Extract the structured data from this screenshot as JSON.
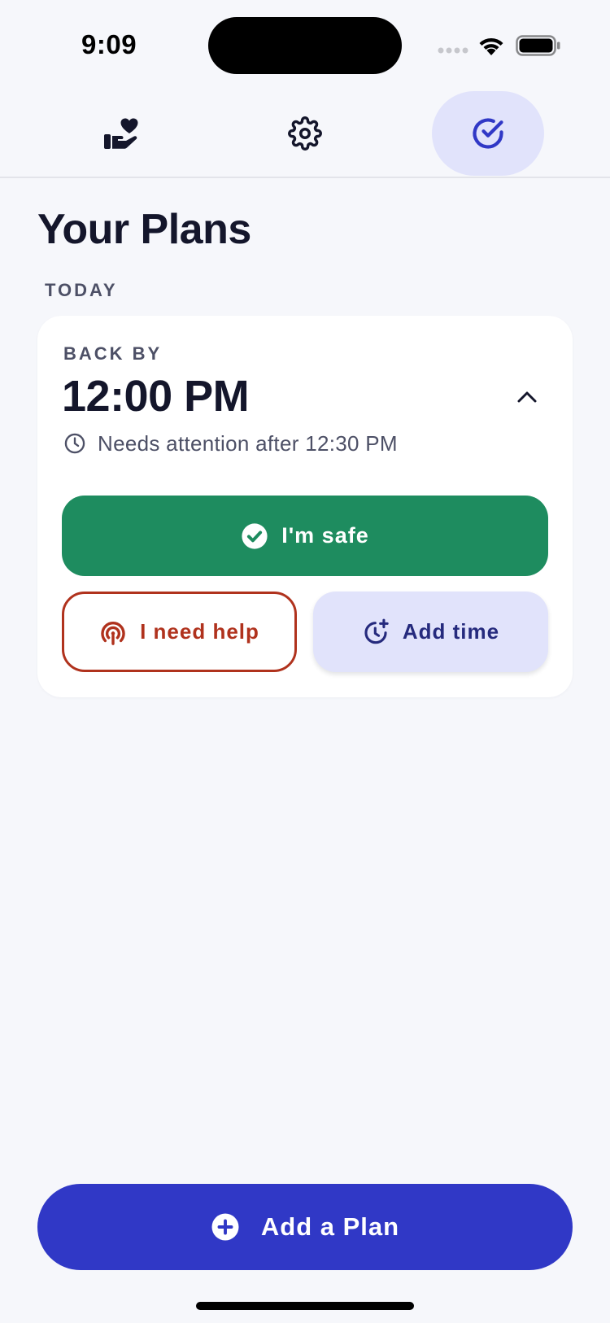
{
  "status_bar": {
    "time": "9:09"
  },
  "tabs": [
    {
      "id": "care",
      "icon": "hand-heart-icon",
      "active": false
    },
    {
      "id": "settings",
      "icon": "gear-icon",
      "active": false
    },
    {
      "id": "plans",
      "icon": "check-circle-icon",
      "active": true
    }
  ],
  "page": {
    "title": "Your Plans",
    "section_label": "TODAY"
  },
  "plan": {
    "back_by_label": "BACK BY",
    "back_by_time": "12:00 PM",
    "attention_text": "Needs attention after 12:30 PM",
    "safe_label": "I'm safe",
    "help_label": "I need help",
    "add_time_label": "Add time"
  },
  "footer": {
    "add_plan_label": "Add a Plan"
  },
  "colors": {
    "background": "#f6f7fb",
    "accent": "#3038c6",
    "active_tab_bg": "#e1e3fb",
    "safe_green": "#1e8c5f",
    "help_red": "#b0321d",
    "text_dark": "#14162b",
    "text_muted": "#4d5066"
  }
}
